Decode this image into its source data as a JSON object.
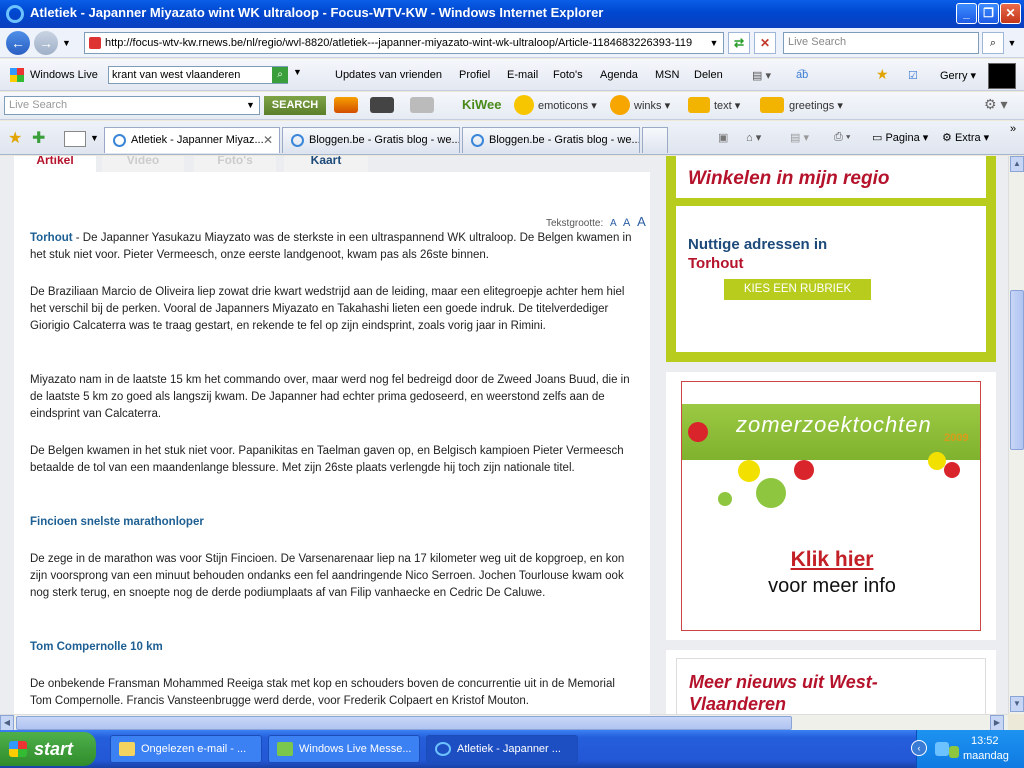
{
  "window": {
    "title": "Atletiek - Japanner Miyazato wint WK ultraloop - Focus-WTV-KW - Windows Internet Explorer",
    "minimize": "_",
    "maximize": "❐",
    "close": "✕"
  },
  "addressbar": {
    "url": "http://focus-wtv-kw.rnews.be/nl/regio/wvl-8820/atletiek---japanner-miyazato-wint-wk-ultraloop/Article-1184683226393-119",
    "search_placeholder": "Live Search"
  },
  "wltoolbar": {
    "brand": "Windows Live",
    "search_value": "krant van west vlaanderen",
    "items": [
      "Updates van vrienden",
      "Profiel",
      "E-mail",
      "Foto's",
      "Agenda",
      "MSN",
      "Delen"
    ],
    "user": "Gerry"
  },
  "lstoolbar": {
    "search_placeholder": "Live Search",
    "search_button": "SEARCH",
    "kiwee": "KiWee",
    "emoticons": "emoticons",
    "winks": "winks",
    "text": "text",
    "greetings": "greetings"
  },
  "tabs": [
    {
      "label": "Atletiek - Japanner Miyaz...",
      "active": true
    },
    {
      "label": "Bloggen.be - Gratis blog - we...",
      "active": false
    },
    {
      "label": "Bloggen.be - Gratis blog - we...",
      "active": false
    }
  ],
  "commandbar": {
    "page": "Pagina",
    "extra": "Extra"
  },
  "article": {
    "tabs": [
      "Artikel",
      "Video",
      "Foto's",
      "Kaart"
    ],
    "textsize_label": "Tekstgrootte:",
    "textsize_options": [
      "A",
      "A",
      "A"
    ],
    "paragraphs": [
      {
        "lead": "Torhout",
        "text": " - De Japanner Yasukazu Miayzato was de sterkste in een ultraspannend WK ultraloop. De Belgen kwamen in het stuk niet voor. Pieter Vermeesch, onze eerste landgenoot, kwam pas als 26ste binnen."
      },
      {
        "text": "De Braziliaan Marcio de Oliveira liep zowat drie kwart wedstrijd aan de leiding, maar een elitegroepje achter hem hiel het verschil bij de perken. Vooral de Japanners Miyazato en Takahashi lieten een goede indruk. De titelverdediger Giorigio Calcaterra was te traag gestart, en rekende te fel op zijn eindsprint, zoals vorig jaar in Rimini."
      },
      {
        "text": "Miyazato nam in de laatste 15 km het commando over, maar werd nog fel bedreigd door de Zweed Joans Buud, die in de laatste 5 km zo goed als langszij kwam. De Japanner had echter prima gedoseerd, en weerstond zelfs aan de eindsprint van Calcaterra."
      },
      {
        "text": "De Belgen kwamen in het stuk niet voor. Papanikitas en Taelman gaven op, en Belgisch kampioen Pieter Vermeesch betaalde de tol van een maandenlange blessure. Met zijn 26ste plaats verlengde hij toch zijn nationale titel."
      },
      {
        "text": "De zege in de marathon was voor Stijn Fincioen. De Varsenarenaar liep na 17 kilometer weg uit de kopgroep, en kon zijn voorsprong van een minuut behouden ondanks een fel aandringende Nico Serroen. Jochen Tourlouse kwam ook nog sterk terug, en snoepte nog de derde podiumplaats af van Filip vanhaecke en Cedric De Caluwe."
      },
      {
        "text": "De onbekende Fransman Mohammed Reeiga stak met kop en schouders boven de concurrentie uit in de Memorial Tom Compernolle. Francis Vansteenbrugge  werd derde, voor Frederik Colpaert en Kristof Mouton."
      }
    ],
    "subheads": [
      "Fincioen snelste marathonloper",
      "Tom Compernolle 10 km"
    ]
  },
  "sidebar": {
    "shop_heading": "Winkelen in mijn regio",
    "addresses_line1": "Nuttige adressen in",
    "addresses_line2": "Torhout",
    "kies_button": "KIES EEN RUBRIEK",
    "ad_title": "zomerzoektochten",
    "ad_year": "2009",
    "ad_klik": "Klik hier",
    "ad_meer": "voor meer info",
    "news_heading": "Meer nieuws uit West-Vlaanderen"
  },
  "taskbar": {
    "start": "start",
    "tasks": [
      {
        "label": "Ongelezen e-mail - ...",
        "active": false
      },
      {
        "label": "Windows Live Messe...",
        "active": false
      },
      {
        "label": "Atletiek - Japanner ...",
        "active": true
      }
    ],
    "time": "13:52",
    "day": "maandag"
  }
}
